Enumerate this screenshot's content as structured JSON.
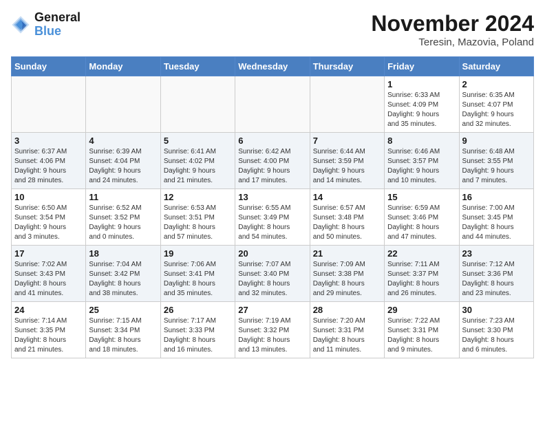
{
  "header": {
    "logo_line1": "General",
    "logo_line2": "Blue",
    "month": "November 2024",
    "location": "Teresin, Mazovia, Poland"
  },
  "weekdays": [
    "Sunday",
    "Monday",
    "Tuesday",
    "Wednesday",
    "Thursday",
    "Friday",
    "Saturday"
  ],
  "weeks": [
    [
      {
        "day": "",
        "info": ""
      },
      {
        "day": "",
        "info": ""
      },
      {
        "day": "",
        "info": ""
      },
      {
        "day": "",
        "info": ""
      },
      {
        "day": "",
        "info": ""
      },
      {
        "day": "1",
        "info": "Sunrise: 6:33 AM\nSunset: 4:09 PM\nDaylight: 9 hours\nand 35 minutes."
      },
      {
        "day": "2",
        "info": "Sunrise: 6:35 AM\nSunset: 4:07 PM\nDaylight: 9 hours\nand 32 minutes."
      }
    ],
    [
      {
        "day": "3",
        "info": "Sunrise: 6:37 AM\nSunset: 4:06 PM\nDaylight: 9 hours\nand 28 minutes."
      },
      {
        "day": "4",
        "info": "Sunrise: 6:39 AM\nSunset: 4:04 PM\nDaylight: 9 hours\nand 24 minutes."
      },
      {
        "day": "5",
        "info": "Sunrise: 6:41 AM\nSunset: 4:02 PM\nDaylight: 9 hours\nand 21 minutes."
      },
      {
        "day": "6",
        "info": "Sunrise: 6:42 AM\nSunset: 4:00 PM\nDaylight: 9 hours\nand 17 minutes."
      },
      {
        "day": "7",
        "info": "Sunrise: 6:44 AM\nSunset: 3:59 PM\nDaylight: 9 hours\nand 14 minutes."
      },
      {
        "day": "8",
        "info": "Sunrise: 6:46 AM\nSunset: 3:57 PM\nDaylight: 9 hours\nand 10 minutes."
      },
      {
        "day": "9",
        "info": "Sunrise: 6:48 AM\nSunset: 3:55 PM\nDaylight: 9 hours\nand 7 minutes."
      }
    ],
    [
      {
        "day": "10",
        "info": "Sunrise: 6:50 AM\nSunset: 3:54 PM\nDaylight: 9 hours\nand 3 minutes."
      },
      {
        "day": "11",
        "info": "Sunrise: 6:52 AM\nSunset: 3:52 PM\nDaylight: 9 hours\nand 0 minutes."
      },
      {
        "day": "12",
        "info": "Sunrise: 6:53 AM\nSunset: 3:51 PM\nDaylight: 8 hours\nand 57 minutes."
      },
      {
        "day": "13",
        "info": "Sunrise: 6:55 AM\nSunset: 3:49 PM\nDaylight: 8 hours\nand 54 minutes."
      },
      {
        "day": "14",
        "info": "Sunrise: 6:57 AM\nSunset: 3:48 PM\nDaylight: 8 hours\nand 50 minutes."
      },
      {
        "day": "15",
        "info": "Sunrise: 6:59 AM\nSunset: 3:46 PM\nDaylight: 8 hours\nand 47 minutes."
      },
      {
        "day": "16",
        "info": "Sunrise: 7:00 AM\nSunset: 3:45 PM\nDaylight: 8 hours\nand 44 minutes."
      }
    ],
    [
      {
        "day": "17",
        "info": "Sunrise: 7:02 AM\nSunset: 3:43 PM\nDaylight: 8 hours\nand 41 minutes."
      },
      {
        "day": "18",
        "info": "Sunrise: 7:04 AM\nSunset: 3:42 PM\nDaylight: 8 hours\nand 38 minutes."
      },
      {
        "day": "19",
        "info": "Sunrise: 7:06 AM\nSunset: 3:41 PM\nDaylight: 8 hours\nand 35 minutes."
      },
      {
        "day": "20",
        "info": "Sunrise: 7:07 AM\nSunset: 3:40 PM\nDaylight: 8 hours\nand 32 minutes."
      },
      {
        "day": "21",
        "info": "Sunrise: 7:09 AM\nSunset: 3:38 PM\nDaylight: 8 hours\nand 29 minutes."
      },
      {
        "day": "22",
        "info": "Sunrise: 7:11 AM\nSunset: 3:37 PM\nDaylight: 8 hours\nand 26 minutes."
      },
      {
        "day": "23",
        "info": "Sunrise: 7:12 AM\nSunset: 3:36 PM\nDaylight: 8 hours\nand 23 minutes."
      }
    ],
    [
      {
        "day": "24",
        "info": "Sunrise: 7:14 AM\nSunset: 3:35 PM\nDaylight: 8 hours\nand 21 minutes."
      },
      {
        "day": "25",
        "info": "Sunrise: 7:15 AM\nSunset: 3:34 PM\nDaylight: 8 hours\nand 18 minutes."
      },
      {
        "day": "26",
        "info": "Sunrise: 7:17 AM\nSunset: 3:33 PM\nDaylight: 8 hours\nand 16 minutes."
      },
      {
        "day": "27",
        "info": "Sunrise: 7:19 AM\nSunset: 3:32 PM\nDaylight: 8 hours\nand 13 minutes."
      },
      {
        "day": "28",
        "info": "Sunrise: 7:20 AM\nSunset: 3:31 PM\nDaylight: 8 hours\nand 11 minutes."
      },
      {
        "day": "29",
        "info": "Sunrise: 7:22 AM\nSunset: 3:31 PM\nDaylight: 8 hours\nand 9 minutes."
      },
      {
        "day": "30",
        "info": "Sunrise: 7:23 AM\nSunset: 3:30 PM\nDaylight: 8 hours\nand 6 minutes."
      }
    ]
  ]
}
